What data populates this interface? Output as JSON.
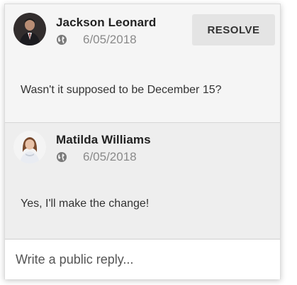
{
  "thread": {
    "comments": [
      {
        "author": "Jackson Leonard",
        "date": "6/05/2018",
        "visibility_icon": "globe-icon",
        "text": "Wasn't it supposed to be December 15?"
      },
      {
        "author": "Matilda Williams",
        "date": "6/05/2018",
        "visibility_icon": "globe-icon",
        "text": "Yes, I'll make the change!"
      }
    ],
    "resolve_label": "RESOLVE",
    "reply_placeholder": "Write a public reply..."
  },
  "colors": {
    "comment_bg": "#f5f5f5",
    "reply_comment_bg": "#eeeeee",
    "button_bg": "#e4e4e4",
    "date_text": "#8a8a8a",
    "icon_grey": "#7a7a7a"
  }
}
